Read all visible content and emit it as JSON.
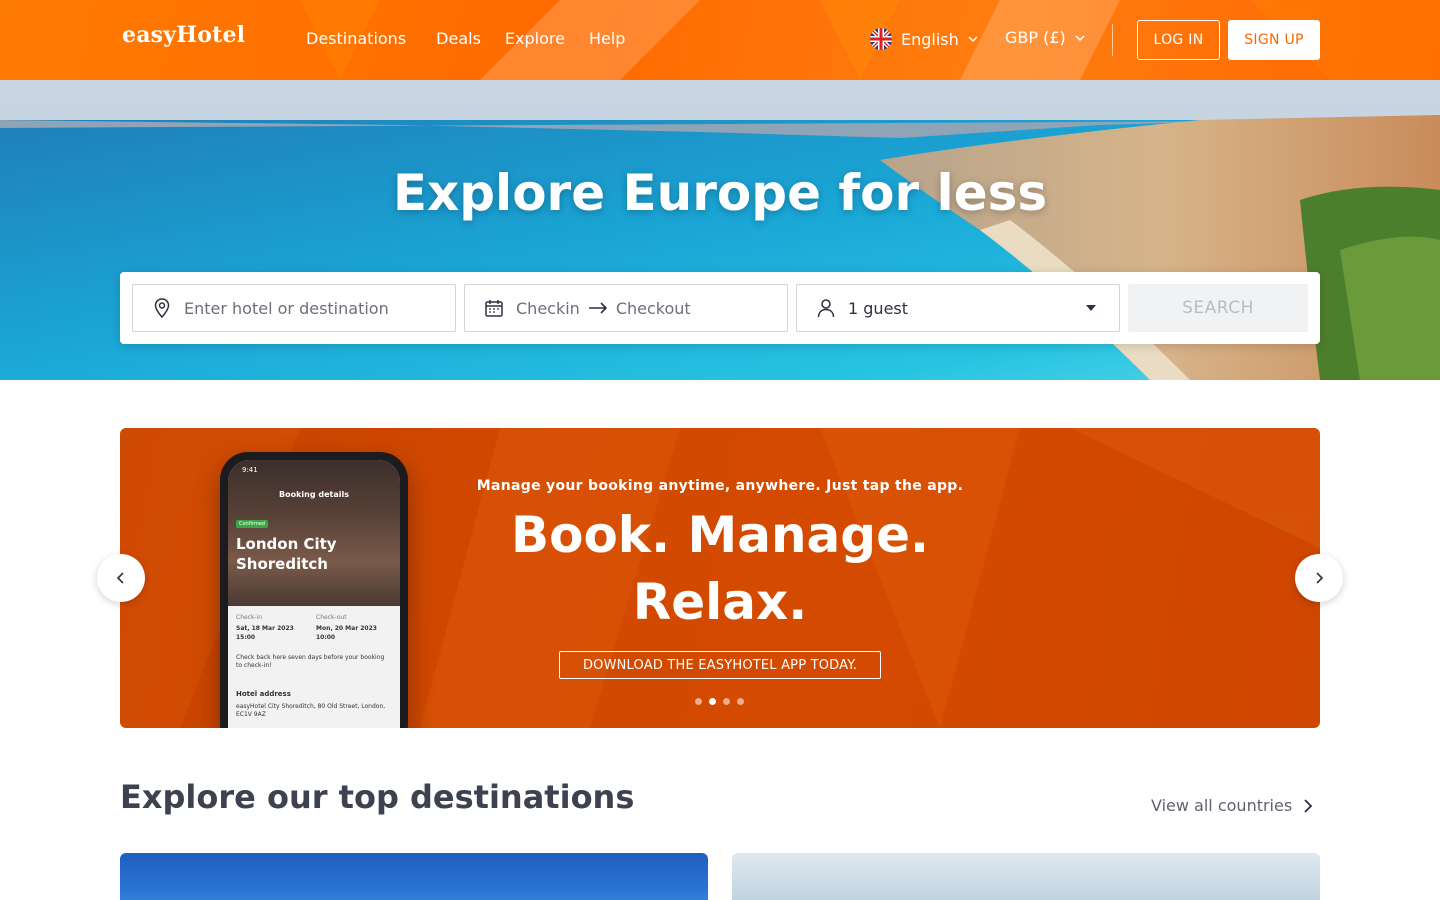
{
  "brand": {
    "logo_text": "easyHotel",
    "accent": "#ff6600",
    "promo_color": "#cf4600"
  },
  "header": {
    "nav": [
      "Destinations",
      "Deals",
      "Explore",
      "Help"
    ],
    "language": "English",
    "currency": "GBP (£)",
    "login_label": "LOG IN",
    "signup_label": "SIGN UP"
  },
  "hero": {
    "title": "Explore Europe for less",
    "search": {
      "destination_placeholder": "Enter hotel or destination",
      "checkin_label": "Checkin",
      "checkout_label": "Checkout",
      "guests_value": "1 guest",
      "search_label": "SEARCH"
    }
  },
  "promo": {
    "subtitle": "Manage your booking anytime, anywhere. Just tap the app.",
    "title_line1": "Book. Manage.",
    "title_line2": "Relax.",
    "cta": "DOWNLOAD THE EASYHOTEL APP TODAY.",
    "slides_count": 4,
    "active_slide": 2,
    "phone": {
      "time": "9:41",
      "header": "Booking details",
      "badge": "Confirmed",
      "hotel_line1": "London City",
      "hotel_line2": "Shoreditch",
      "checkin_label": "Check-in",
      "checkin_date": "Sat, 18 Mar 2023",
      "checkin_time": "15:00",
      "checkout_label": "Check-out",
      "checkout_date": "Mon, 20 Mar 2023",
      "checkout_time": "10:00",
      "note": "Check back here seven days before your booking to check-in!",
      "address_label": "Hotel address",
      "address": "easyHotel City Shoreditch, 80 Old Street, London, EC1V 9AZ"
    }
  },
  "destinations": {
    "title": "Explore our top destinations",
    "view_all": "View all countries"
  },
  "icons": [
    "uk-flag-icon",
    "chevron-down-icon",
    "location-pin-icon",
    "calendar-icon",
    "arrow-right-icon",
    "user-icon",
    "caret-down-icon",
    "chevron-left-icon",
    "chevron-right-icon"
  ]
}
